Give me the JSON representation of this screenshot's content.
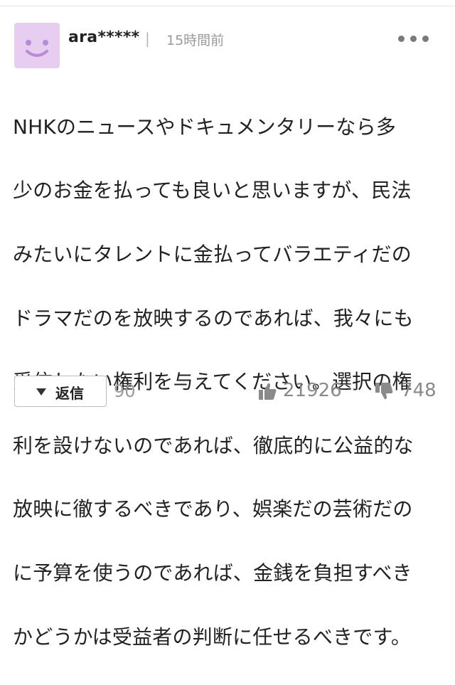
{
  "comment": {
    "username": "ara*****",
    "separator": "|",
    "timestamp": "15時間前",
    "body_lines": [
      "NHKのニュースやドキュメンタリーなら多",
      "少のお金を払っても良いと思いますが、民法",
      "みたいにタレントに金払ってバラエティだの",
      "ドラマだのを放映するのであれば、我々にも",
      "受信しない権利を与えてください。選択の権",
      "利を設けないのであれば、徹底的に公益的な",
      "放映に徹するべきであり、娯楽だの芸術だの",
      "に予算を使うのであれば、金銭を負担すべき",
      "かどうかは受益者の判断に任せるべきです。"
    ]
  },
  "actions": {
    "reply_label": "返信",
    "reply_count": "90",
    "like_count": "21926",
    "dislike_count": "748"
  },
  "colors": {
    "avatar_bg": "#e7cdf0",
    "avatar_face": "#b98ad6",
    "muted_text": "#9a9a9a"
  },
  "icons": {
    "avatar": "smiley-face-icon",
    "more": "more-dots-icon",
    "reply": "triangle-down-icon",
    "like": "thumbs-up-icon",
    "dislike": "thumbs-down-icon"
  }
}
